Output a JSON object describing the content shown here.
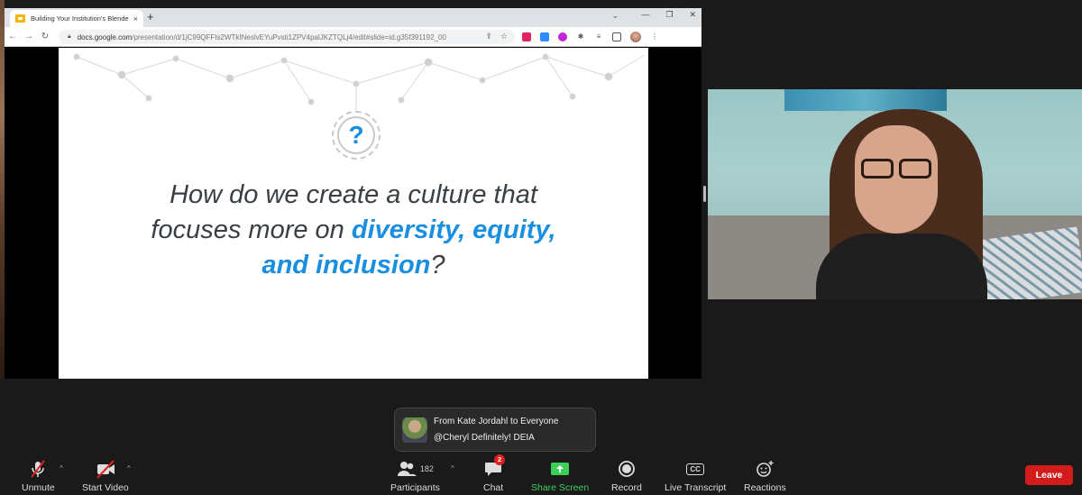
{
  "browser": {
    "tab_title": "Building Your Institution's Blende",
    "tab_close": "×",
    "new_tab": "+",
    "url_host": "docs.google.com",
    "url_path": "/presentation/d/1jC99QFFIs2WTkINeslvEYuPvsti1ZPV4palJKZTQLj4/edit#slide=id.g35f391192_00"
  },
  "slide": {
    "question_mark": "?",
    "line1": "How do we create a culture that",
    "line2_plain": "focuses more on ",
    "line2_highlight": "diversity, equity,",
    "line3_highlight": "and inclusion",
    "line3_tail": "?"
  },
  "chat_toast": {
    "sender": "From Kate Jordahl to Everyone",
    "message": "@Cheryl Definitely! DEIA"
  },
  "zoom_toolbar": {
    "unmute": "Unmute",
    "start_video": "Start Video",
    "participants": "Participants",
    "participants_count": "182",
    "chat": "Chat",
    "chat_badge": "2",
    "share_screen": "Share Screen",
    "record": "Record",
    "live_transcript": "Live Transcript",
    "live_transcript_icon_text": "CC",
    "reactions": "Reactions",
    "leave": "Leave"
  },
  "colors": {
    "accent_blue": "#1a8fe0",
    "share_green": "#3ecf5b",
    "leave_red": "#d21c1c"
  }
}
